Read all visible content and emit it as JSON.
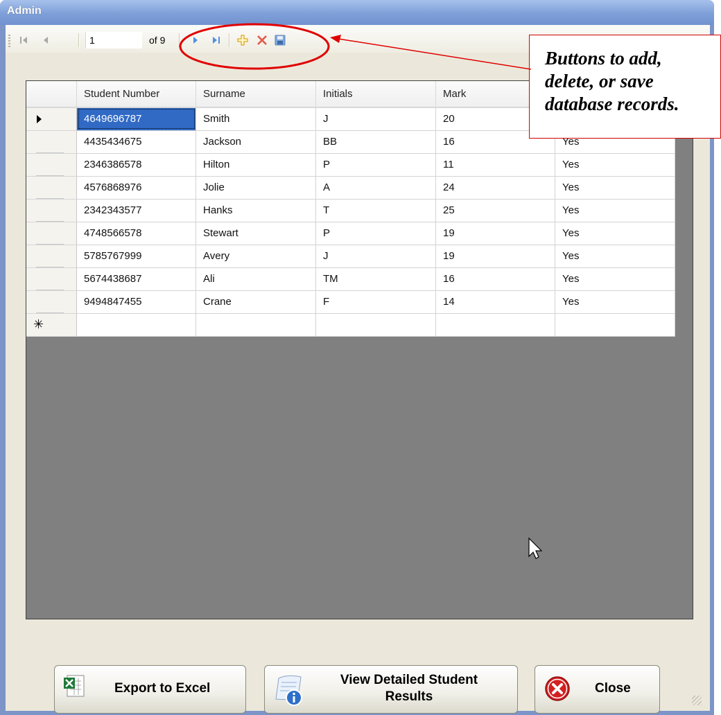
{
  "window": {
    "title": "Admin"
  },
  "navigator": {
    "position": "1",
    "count_label": "of 9",
    "buttons": [
      "move-first-icon",
      "move-previous-icon",
      "move-next-icon",
      "move-last-icon",
      "add-new-icon",
      "delete-icon",
      "save-icon"
    ]
  },
  "grid": {
    "columns": [
      "Student Number",
      "Surname",
      "Initials",
      "Mark",
      ""
    ],
    "rows": [
      {
        "student_number": "4649696787",
        "surname": "Smith",
        "initials": "J",
        "mark": "20",
        "extra": ""
      },
      {
        "student_number": "4435434675",
        "surname": "Jackson",
        "initials": "BB",
        "mark": "16",
        "extra": "Yes"
      },
      {
        "student_number": "2346386578",
        "surname": "Hilton",
        "initials": "P",
        "mark": "11",
        "extra": "Yes"
      },
      {
        "student_number": "4576868976",
        "surname": "Jolie",
        "initials": "A",
        "mark": "24",
        "extra": "Yes"
      },
      {
        "student_number": "2342343577",
        "surname": "Hanks",
        "initials": "T",
        "mark": "25",
        "extra": "Yes"
      },
      {
        "student_number": "4748566578",
        "surname": "Stewart",
        "initials": "P",
        "mark": "19",
        "extra": "Yes"
      },
      {
        "student_number": "5785767999",
        "surname": "Avery",
        "initials": "J",
        "mark": "19",
        "extra": "Yes"
      },
      {
        "student_number": "5674438687",
        "surname": "Ali",
        "initials": "TM",
        "mark": "16",
        "extra": "Yes"
      },
      {
        "student_number": "9494847455",
        "surname": "Crane",
        "initials": "F",
        "mark": "14",
        "extra": "Yes"
      }
    ],
    "selected_row": 0
  },
  "buttons": {
    "export": "Export to Excel",
    "details_line1": "View Detailed Student",
    "details_line2": "Results",
    "close": "Close"
  },
  "annotation": {
    "line1": "Buttons to add,",
    "line2": "delete, or save",
    "line3": "database records."
  },
  "colors": {
    "annotation_red": "#e00000",
    "selection_blue": "#316ac5",
    "grid_background": "#808080"
  }
}
